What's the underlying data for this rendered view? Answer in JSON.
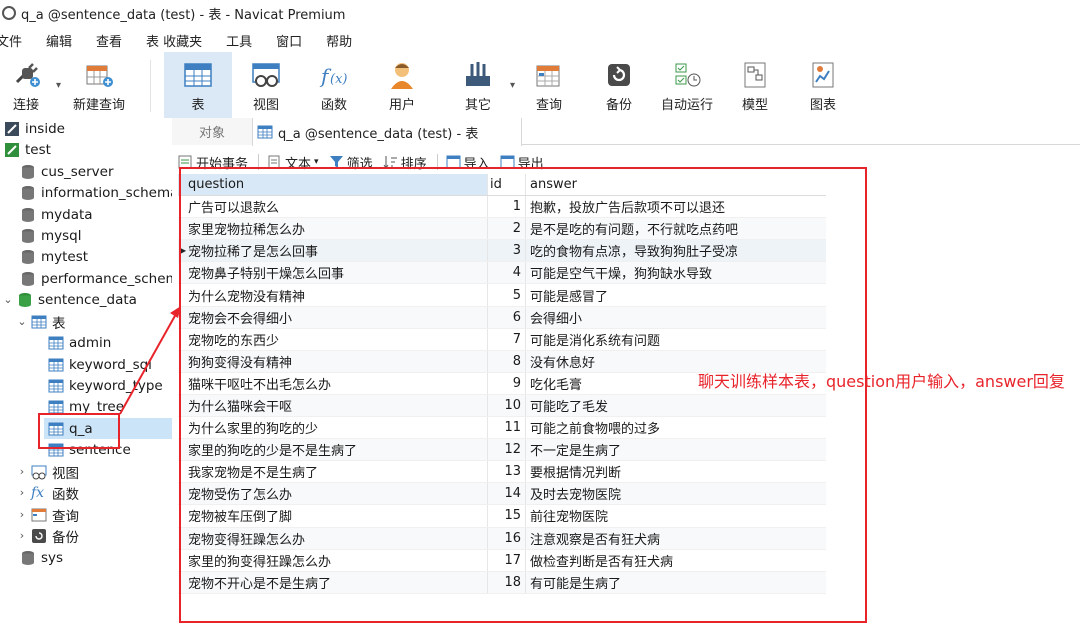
{
  "window": {
    "title": "q_a @sentence_data (test) - 表 - Navicat Premium"
  },
  "menu": [
    "文件",
    "编辑",
    "查看",
    "表",
    "收藏夹",
    "工具",
    "窗口",
    "帮助"
  ],
  "toolbar": {
    "connect": "连接",
    "new_query": "新建查询",
    "table": "表",
    "view": "视图",
    "function": "函数",
    "user": "用户",
    "other": "其它",
    "query": "查询",
    "backup": "备份",
    "automation": "自动运行",
    "model": "模型",
    "chart": "图表"
  },
  "sidebar": {
    "connections": [
      "inside",
      "test"
    ],
    "databases": [
      "cus_server",
      "information_schema",
      "mydata",
      "mysql",
      "mytest",
      "performance_schema"
    ],
    "open_db": "sentence_data",
    "tables_group": "表",
    "tables": [
      "admin",
      "keyword_sql",
      "keyword_type",
      "my_tree",
      "q_a",
      "sentence"
    ],
    "groups": [
      "视图",
      "函数",
      "查询",
      "备份"
    ],
    "last_db": "sys"
  },
  "tabs": {
    "objects": "对象",
    "active": "q_a @sentence_data (test) - 表"
  },
  "subtoolbar": {
    "begin_tx": "开始事务",
    "text": "文本",
    "filter": "筛选",
    "sort": "排序",
    "import": "导入",
    "export": "导出"
  },
  "grid": {
    "columns": [
      "question",
      "id",
      "answer"
    ],
    "rows": [
      {
        "question": "广告可以退款么",
        "id": "1",
        "answer": "抱歉，投放广告后款项不可以退还"
      },
      {
        "question": "家里宠物拉稀怎么办",
        "id": "2",
        "answer": "是不是吃的有问题，不行就吃点药吧"
      },
      {
        "question": "宠物拉稀了是怎么回事",
        "id": "3",
        "answer": "吃的食物有点凉，导致狗狗肚子受凉"
      },
      {
        "question": "宠物鼻子特别干燥怎么回事",
        "id": "4",
        "answer": "可能是空气干燥，狗狗缺水导致"
      },
      {
        "question": "为什么宠物没有精神",
        "id": "5",
        "answer": "可能是感冒了"
      },
      {
        "question": "宠物会不会得细小",
        "id": "6",
        "answer": "会得细小"
      },
      {
        "question": "宠物吃的东西少",
        "id": "7",
        "answer": "可能是消化系统有问题"
      },
      {
        "question": "狗狗变得没有精神",
        "id": "8",
        "answer": "没有休息好"
      },
      {
        "question": "猫咪干呕吐不出毛怎么办",
        "id": "9",
        "answer": "吃化毛膏"
      },
      {
        "question": "为什么猫咪会干呕",
        "id": "10",
        "answer": "可能吃了毛发"
      },
      {
        "question": "为什么家里的狗吃的少",
        "id": "11",
        "answer": "可能之前食物喂的过多"
      },
      {
        "question": "家里的狗吃的少是不是生病了",
        "id": "12",
        "answer": "不一定是生病了"
      },
      {
        "question": "我家宠物是不是生病了",
        "id": "13",
        "answer": "要根据情况判断"
      },
      {
        "question": "宠物受伤了怎么办",
        "id": "14",
        "answer": "及时去宠物医院"
      },
      {
        "question": "宠物被车压倒了脚",
        "id": "15",
        "answer": "前往宠物医院"
      },
      {
        "question": "宠物变得狂躁怎么办",
        "id": "16",
        "answer": "注意观察是否有狂犬病"
      },
      {
        "question": "家里的狗变得狂躁怎么办",
        "id": "17",
        "answer": "做检查判断是否有狂犬病"
      },
      {
        "question": "宠物不开心是不是生病了",
        "id": "18",
        "answer": "有可能是生病了"
      }
    ]
  },
  "annotation": {
    "note": "聊天训练样本表，question用户输入，answer回复",
    "color": "#e8242b"
  }
}
